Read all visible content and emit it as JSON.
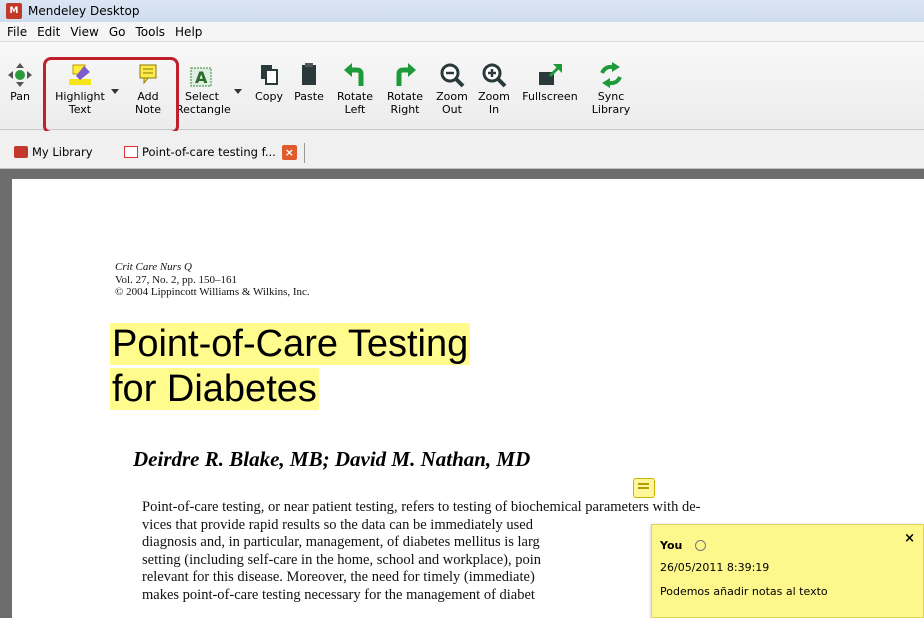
{
  "window": {
    "title": "Mendeley Desktop"
  },
  "menu": [
    "File",
    "Edit",
    "View",
    "Go",
    "Tools",
    "Help"
  ],
  "toolbar": {
    "pan": "Pan",
    "highlight": [
      "Highlight",
      "Text"
    ],
    "add_note": [
      "Add",
      "Note"
    ],
    "select_rect": [
      "Select",
      "Rectangle"
    ],
    "copy": "Copy",
    "paste": "Paste",
    "rotate_left": [
      "Rotate",
      "Left"
    ],
    "rotate_right": [
      "Rotate",
      "Right"
    ],
    "zoom_out": [
      "Zoom",
      "Out"
    ],
    "zoom_in": [
      "Zoom",
      "In"
    ],
    "fullscreen": "Fullscreen",
    "sync": [
      "Sync",
      "Library"
    ]
  },
  "tabs": {
    "library": "My Library",
    "document": "Point-of-care testing f..."
  },
  "document": {
    "journal": "Crit Care Nurs Q",
    "volume": "Vol. 27, No. 2, pp. 150–161",
    "copyright": "© 2004 Lippincott Williams & Wilkins, Inc.",
    "title_line1": "Point-of-Care Testing",
    "title_line2": "for Diabetes",
    "authors": "Deirdre R. Blake, MB; David M. Nathan, MD",
    "abstract_lines": [
      "Point-of-care testing, or near patient testing, refers to testing of biochemical parameters with de-",
      "vices that provide rapid results so the data can be immediately used",
      "diagnosis and, in particular, management, of diabetes mellitus is larg",
      "setting (including self-care in the home, school and workplace), poin",
      "relevant for this disease. Moreover, the need for timely (immediate)",
      "makes point-of-care testing necessary for the management of diabet"
    ]
  },
  "note": {
    "author": "You",
    "timestamp": "26/05/2011 8:39:19",
    "text": "Podemos añadir notas al texto",
    "close": "×"
  },
  "colors": {
    "highlight": "#fffb8c",
    "annotation_ring": "#c0202a",
    "note_bg": "#fdf78c"
  }
}
